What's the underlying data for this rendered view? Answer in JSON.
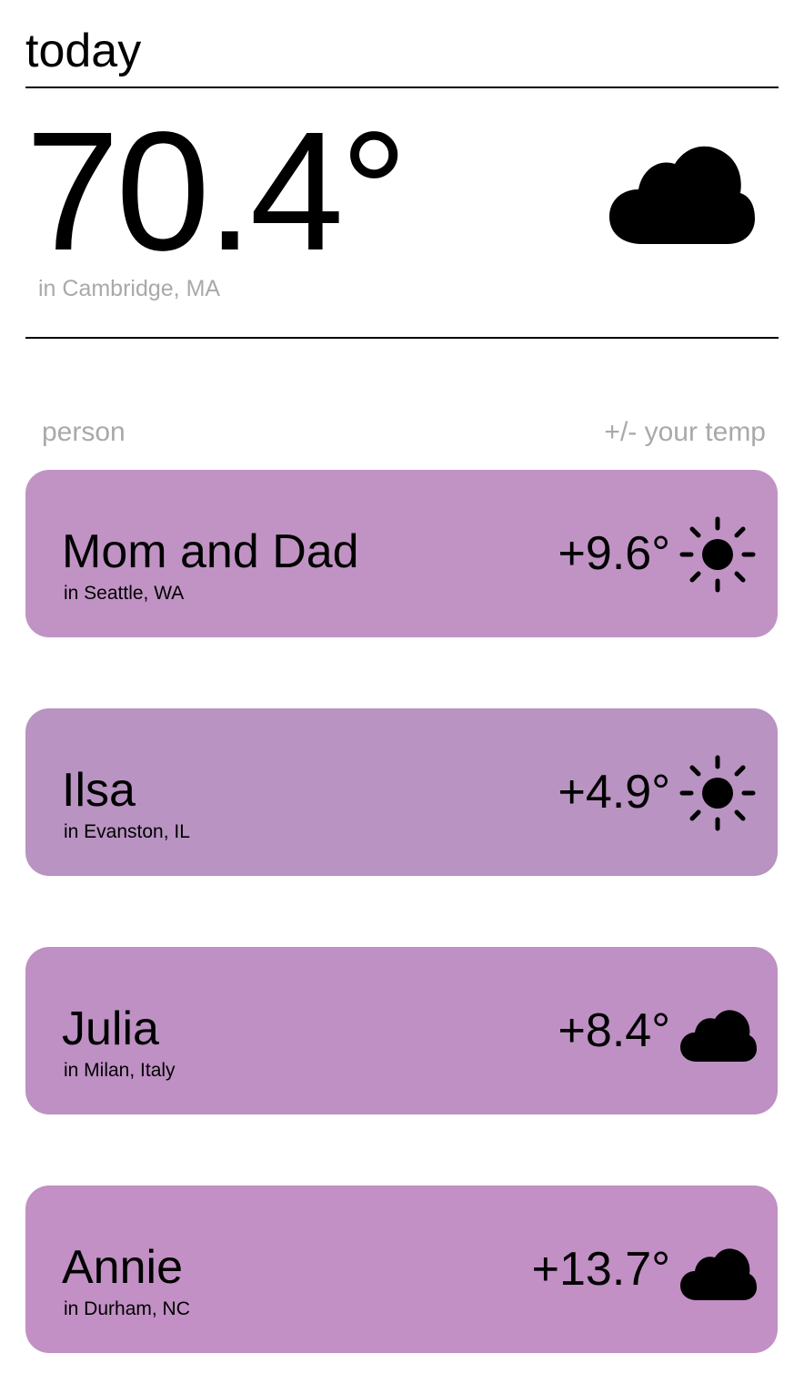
{
  "header": {
    "title": "today"
  },
  "current": {
    "temperature": "70.4°",
    "location": "in Cambridge, MA",
    "weather_icon": "cloud-icon"
  },
  "columns": {
    "left": "person",
    "right": "+/- your temp"
  },
  "people": [
    {
      "name": "Mom and Dad",
      "location": "in Seattle, WA",
      "delta": "+9.6°",
      "weather_icon": "sun-icon",
      "card_color": "#c193c4"
    },
    {
      "name": "Ilsa",
      "location": "in Evanston, IL",
      "delta": "+4.9°",
      "weather_icon": "sun-icon",
      "card_color": "#b993c1"
    },
    {
      "name": "Julia",
      "location": "in Milan, Italy",
      "delta": "+8.4°",
      "weather_icon": "cloud-icon",
      "card_color": "#be90c3"
    },
    {
      "name": "Annie",
      "location": "in Durham, NC",
      "delta": "+13.7°",
      "weather_icon": "cloud-icon",
      "card_color": "#c290c4"
    }
  ],
  "colors": {
    "muted_text": "#a9a9a9",
    "rule": "#000000"
  }
}
